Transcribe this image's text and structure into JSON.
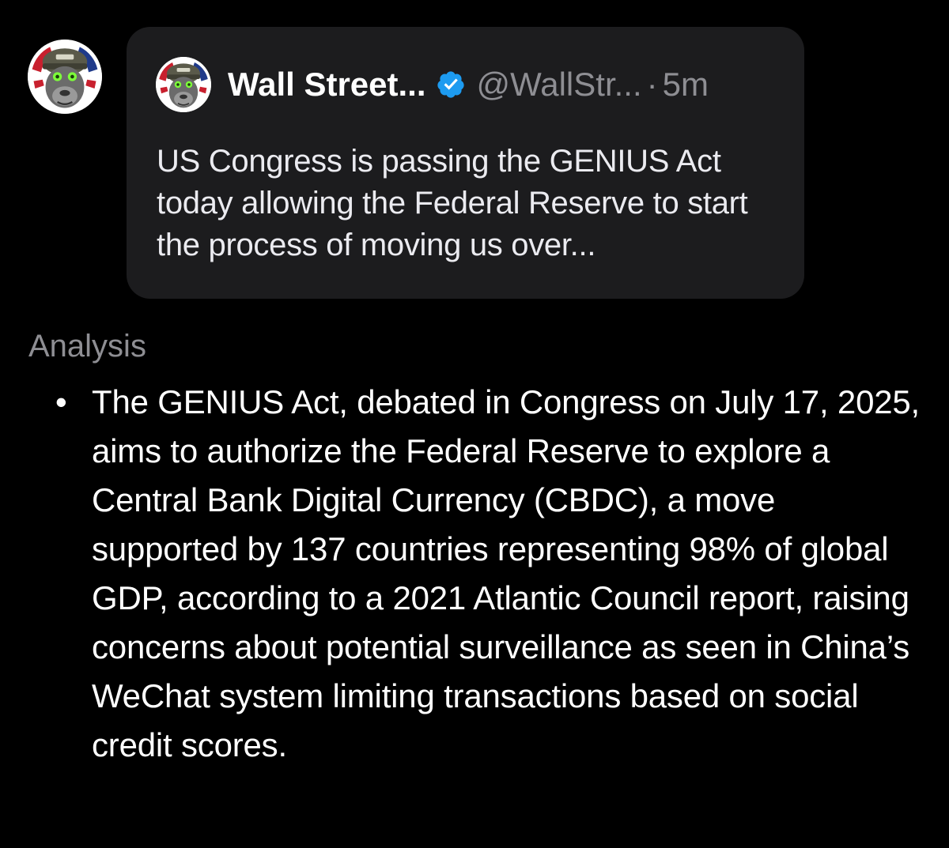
{
  "main_avatar": {
    "icon": "gorilla-soldier-avatar-icon"
  },
  "quoted_post": {
    "avatar_icon": "gorilla-soldier-avatar-icon",
    "author_name": "Wall Street...",
    "verified_icon": "verified-badge-icon",
    "handle": "@WallStr...",
    "separator": "·",
    "time": "5m",
    "text": "US Congress is passing the GENIUS Act today allowing the Federal Reserve to start the process of moving us over..."
  },
  "analysis": {
    "label": "Analysis",
    "bullet_marker": "•",
    "bullets": [
      "The GENIUS Act, debated in Congress on July 17, 2025, aims to authorize the Federal Reserve to explore a Central Bank Digital Currency (CBDC), a move supported by 137 countries representing 98% of global GDP, according to a 2021 Atlantic Council report, raising concerns about potential surveillance as seen in China’s WeChat system limiting transactions based on social credit scores."
    ]
  },
  "colors": {
    "background": "#000000",
    "card_background": "#1c1c1e",
    "secondary_text": "#8e8e93",
    "verified_blue": "#1d9bf0"
  }
}
